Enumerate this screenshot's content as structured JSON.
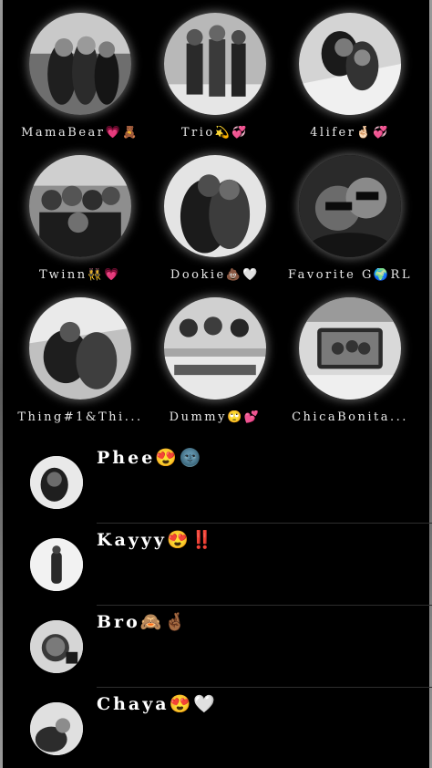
{
  "pinned": [
    {
      "label": "MamaBear💗🧸"
    },
    {
      "label": "Trio💫💞"
    },
    {
      "label": "4lifer🤞🏻💞"
    },
    {
      "label": "Twinn👯‍♀️💗"
    },
    {
      "label": "Dookie💩🤍"
    },
    {
      "label": "Favorite G🌍RL"
    },
    {
      "label": "Thing#1&Thi..."
    },
    {
      "label": "Dummy🙄💕"
    },
    {
      "label": "ChicaBonita..."
    }
  ],
  "chats": [
    {
      "name": "Phee😍🌚"
    },
    {
      "name": "Kayyy😍‼️"
    },
    {
      "name": "Bro🙈🤞🏾"
    },
    {
      "name": "Chaya😍🤍"
    }
  ]
}
